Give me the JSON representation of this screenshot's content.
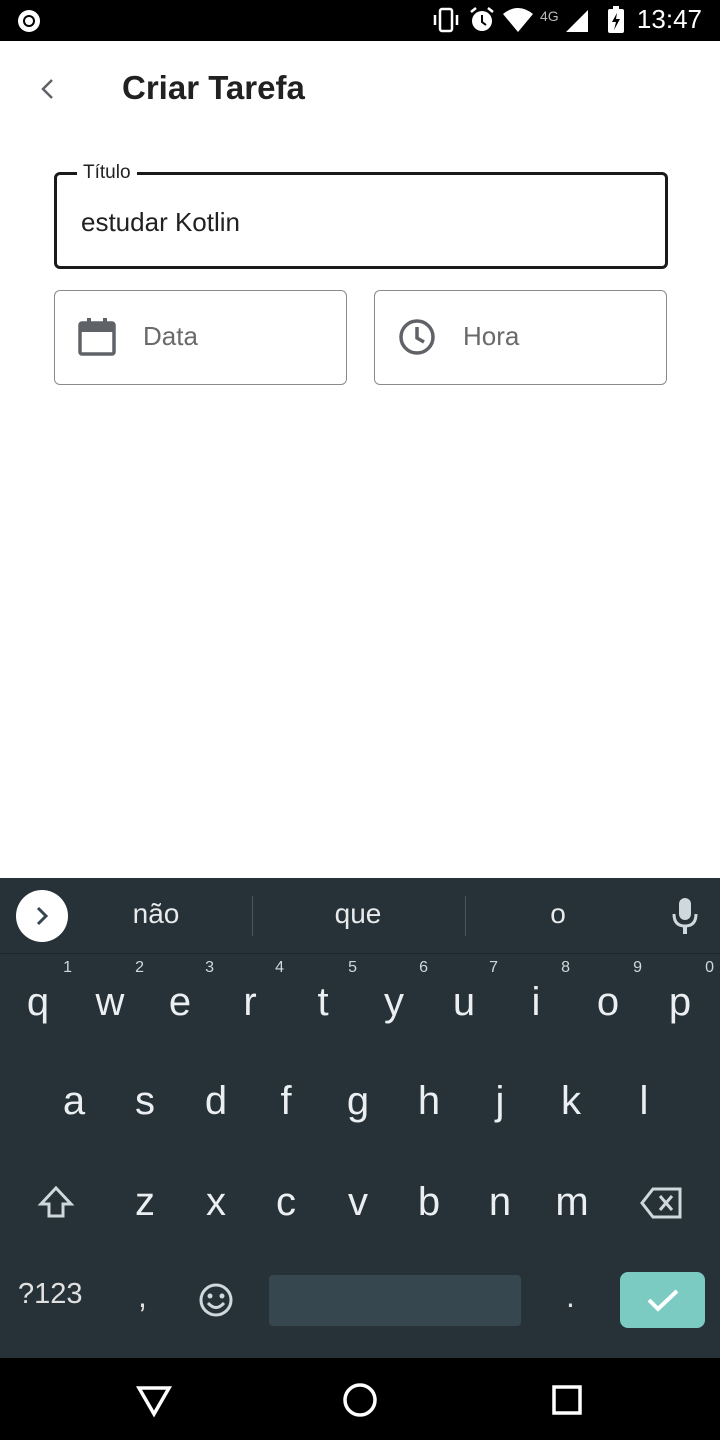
{
  "status_bar": {
    "time": "13:47",
    "network": "4G"
  },
  "app_bar": {
    "title": "Criar Tarefa"
  },
  "form": {
    "title_field": {
      "label": "Título",
      "value": "estudar Kotlin"
    },
    "date_field": {
      "placeholder": "Data",
      "icon": "calendar-icon"
    },
    "time_field": {
      "placeholder": "Hora",
      "icon": "clock-icon"
    }
  },
  "keyboard": {
    "suggestions": [
      "não",
      "que",
      "o"
    ],
    "row1": [
      {
        "key": "q",
        "hint": "1"
      },
      {
        "key": "w",
        "hint": "2"
      },
      {
        "key": "e",
        "hint": "3"
      },
      {
        "key": "r",
        "hint": "4"
      },
      {
        "key": "t",
        "hint": "5"
      },
      {
        "key": "y",
        "hint": "6"
      },
      {
        "key": "u",
        "hint": "7"
      },
      {
        "key": "i",
        "hint": "8"
      },
      {
        "key": "o",
        "hint": "9"
      },
      {
        "key": "p",
        "hint": "0"
      }
    ],
    "row2": [
      "a",
      "s",
      "d",
      "f",
      "g",
      "h",
      "j",
      "k",
      "l"
    ],
    "row3": [
      "z",
      "x",
      "c",
      "v",
      "b",
      "n",
      "m"
    ],
    "symbols_label": "?123",
    "comma": ",",
    "period": "."
  },
  "colors": {
    "accent": "#7ccbc3",
    "keyboard_bg": "#263238",
    "key_text": "#eceff1"
  }
}
